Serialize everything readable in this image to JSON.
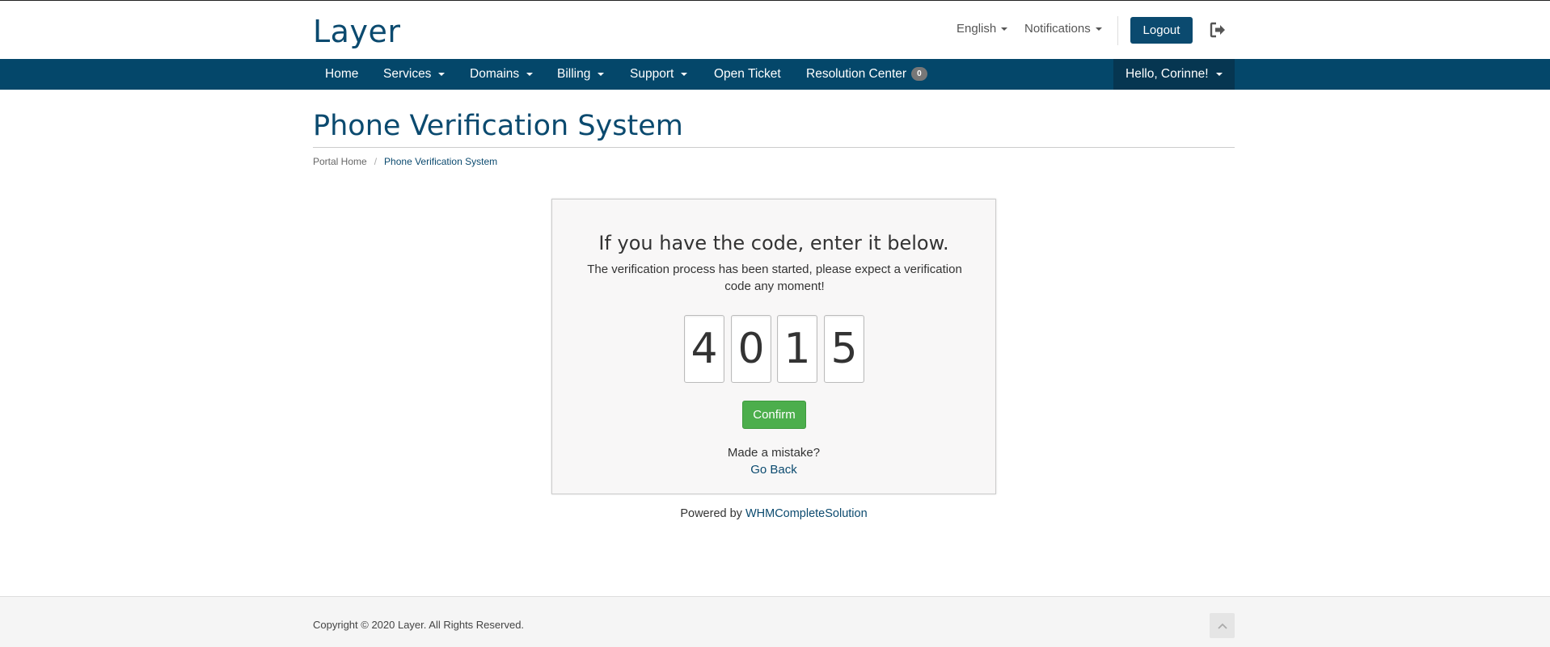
{
  "header": {
    "logo": "Layer",
    "language_label": "English",
    "notifications_label": "Notifications",
    "logout_label": "Logout"
  },
  "navbar": {
    "items": [
      {
        "label": "Home"
      },
      {
        "label": "Services"
      },
      {
        "label": "Domains"
      },
      {
        "label": "Billing"
      },
      {
        "label": "Support"
      },
      {
        "label": "Open Ticket"
      },
      {
        "label": "Resolution Center"
      }
    ],
    "resolution_badge": "0",
    "user_greeting": "Hello, Corinne!"
  },
  "page": {
    "title": "Phone Verification System",
    "breadcrumb": {
      "home": "Portal Home",
      "separator": "/",
      "current": "Phone Verification System"
    }
  },
  "verification": {
    "heading": "If you have the code, enter it below.",
    "message": "The verification process has been started, please expect a verification code any moment!",
    "code_digits": [
      "4",
      "0",
      "1",
      "5"
    ],
    "confirm_label": "Confirm",
    "mistake_text": "Made a mistake?",
    "go_back_label": "Go Back"
  },
  "powered_by": {
    "prefix": "Powered by",
    "link": "WHMCompleteSolution"
  },
  "footer": {
    "copyright": "Copyright © 2020 Layer. All Rights Reserved."
  },
  "colors": {
    "brand": "#0b4a6f",
    "navbar": "#04476a",
    "confirm": "#4cae4c"
  }
}
